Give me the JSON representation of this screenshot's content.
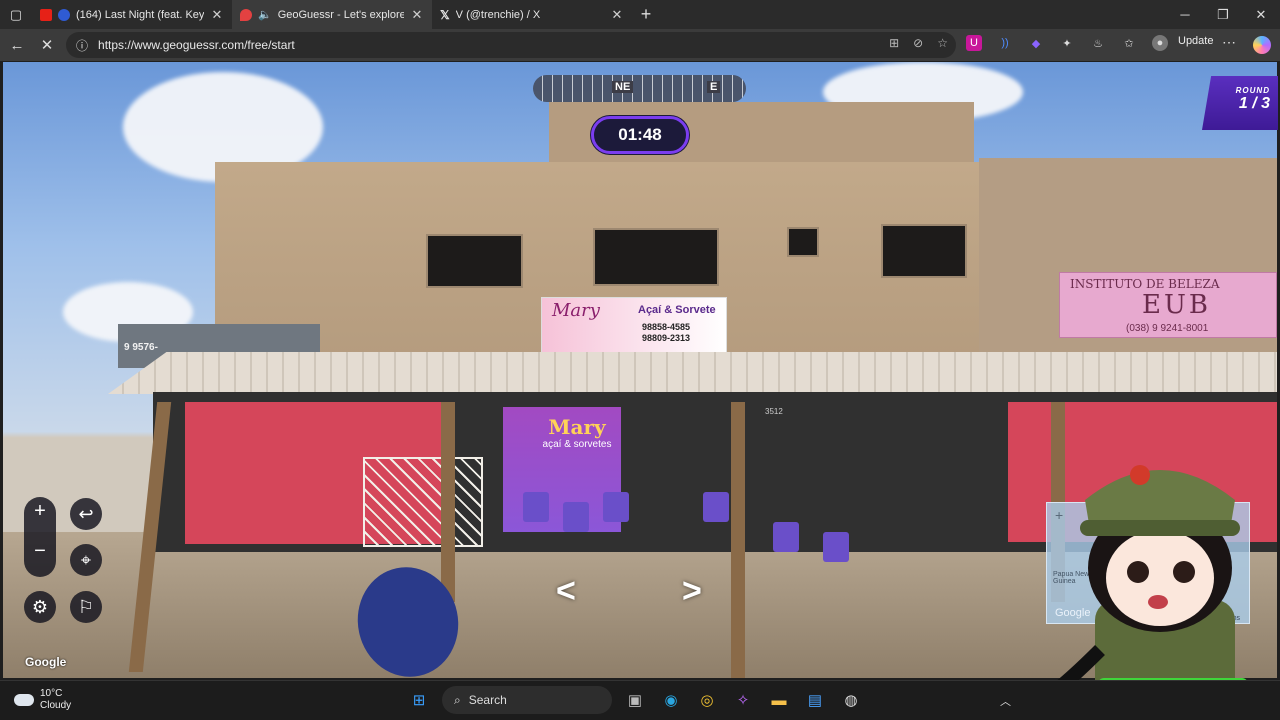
{
  "browser": {
    "tabs": [
      {
        "title": "(164) Last Night (feat. Keyshi",
        "active": false
      },
      {
        "title": "GeoGuessr - Let's explore the",
        "active": true
      },
      {
        "title": "V (@trenchie) / X",
        "active": false
      }
    ],
    "url": "https://www.geoguessr.com/free/start",
    "update_label": "Update"
  },
  "game": {
    "compass": {
      "ne": "NE",
      "e": "E"
    },
    "timer": "01:48",
    "round_label": "ROUND",
    "round_value": "1 / 3",
    "google_watermark": "Google",
    "minimap": {
      "place": "Papua New Guinea",
      "google": "Google",
      "year": "2025",
      "terms": "Terms"
    }
  },
  "scene_text": {
    "mary_sign_title": "Mary",
    "mary_sign_sub": "Açaí & Sorvete",
    "mary_sign_phone1": "98858-4585",
    "mary_sign_phone2": "98809-2313",
    "inst_line1": "INSTITUTO DE BELEZA",
    "inst_line2": "EUB",
    "inst_line3": "(038) 9 9241-8001",
    "left_sign_phone": "9 9576-",
    "banner_title": "Mary",
    "banner_sub": "açaí & sorvetes",
    "street_number": "3512"
  },
  "taskbar": {
    "temp": "10°C",
    "condition": "Cloudy",
    "search_label": "Search"
  },
  "colors": {
    "accent": "#7b3df0",
    "round_bg": "#4a22aa"
  }
}
